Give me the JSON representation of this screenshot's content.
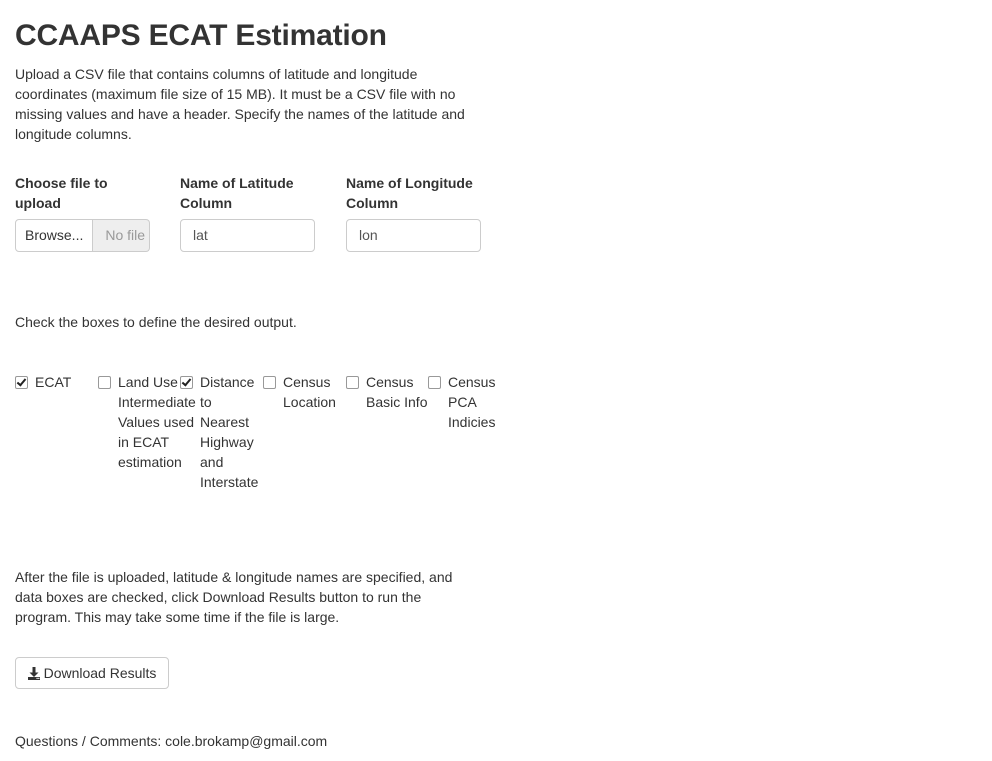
{
  "title": "CCAAPS ECAT Estimation",
  "intro": "Upload a CSV file that contains columns of latitude and longitude coordinates (maximum file size of 15 MB). It must be a CSV file with no missing values and have a header. Specify the names of the latitude and longitude columns.",
  "file_upload": {
    "label": "Choose file to upload",
    "browse_label": "Browse...",
    "file_placeholder": "No file selected"
  },
  "latitude": {
    "label": "Name of Latitude Column",
    "value": "lat"
  },
  "longitude": {
    "label": "Name of Longitude Column",
    "value": "lon"
  },
  "check_instruction": "Check the boxes to define the desired output.",
  "outputs": [
    {
      "label": "ECAT",
      "checked": true
    },
    {
      "label": "Land Use Intermediate Values used in ECAT estimation",
      "checked": false
    },
    {
      "label": "Distance to Nearest Highway and Interstate",
      "checked": true
    },
    {
      "label": "Census Location",
      "checked": false
    },
    {
      "label": "Census Basic Info",
      "checked": false
    },
    {
      "label": "Census PCA Indicies",
      "checked": false
    }
  ],
  "after_text": "After the file is uploaded, latitude & longitude names are specified, and data boxes are checked, click Download Results button to run the program. This may take some time if the file is large.",
  "download_button": {
    "label": "Download Results",
    "icon": "download-icon"
  },
  "contact": "Questions / Comments: cole.brokamp@gmail.com"
}
